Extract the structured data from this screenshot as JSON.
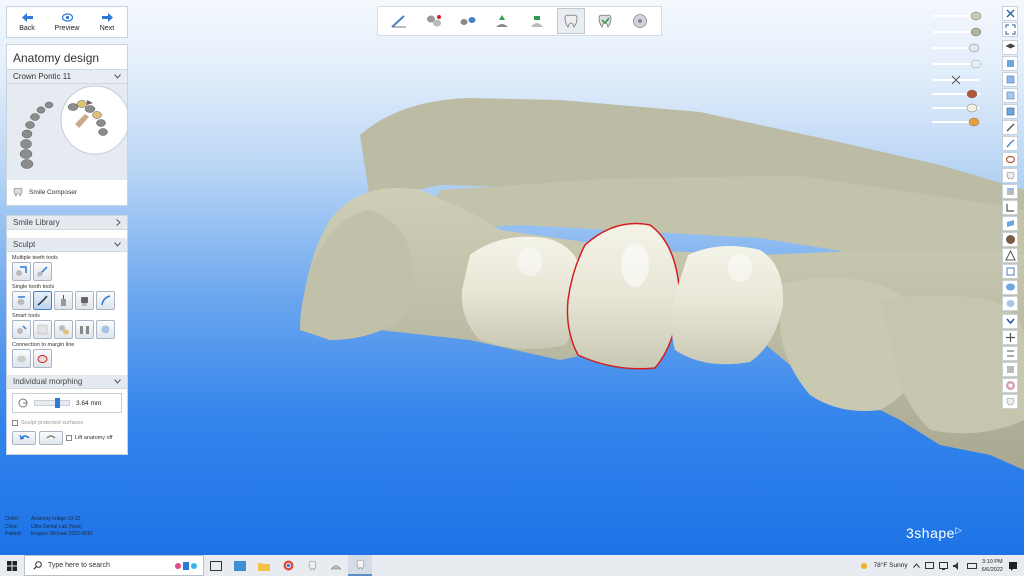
{
  "nav": {
    "back_label": "Back",
    "preview_label": "Preview",
    "next_label": "Next"
  },
  "design_panel": {
    "title": "Anatomy design",
    "crown_select": "Crown Pontic 11",
    "smile_composer_label": "Smile Composer"
  },
  "tools_panel": {
    "smile_library_label": "Smile Library",
    "sculpt_label": "Sculpt",
    "multiple_teeth_label": "Multiple teeth tools",
    "single_tooth_label": "Single tooth tools",
    "smart_tools_label": "Smart tools",
    "margin_line_label": "Connection to margin line",
    "morphing_label": "Individual morphing",
    "morph_value": "3.64 mm",
    "protected_label": "Sculpt protected surfaces",
    "lift_anatomy_label": "Lift anatomy off"
  },
  "order": {
    "order_label": "Order:",
    "order_value": "Anatomy bridge 10-12",
    "client_label": "Clinic:",
    "client_value": "Ultra Dental Lab (New)",
    "patient_label": "Patient:",
    "patient_value": "Krajacic Michael 2022-0616"
  },
  "logo": "3shape",
  "taskbar": {
    "search_placeholder": "Type here to search",
    "weather": "78°F  Sunny",
    "time": "3:10 PM",
    "date": "6/6/2022"
  },
  "colors": {
    "background_top": "#f4f8fd",
    "background_bottom": "#1d73e6",
    "model_color": "#c9c8b1",
    "margin_line": "#d22020",
    "nav_arrow": "#2a7ad6"
  },
  "icons": {
    "back": "arrow-left-icon",
    "preview": "eye-icon",
    "next": "arrow-right-icon",
    "start": "windows-icon",
    "search": "search-icon"
  }
}
